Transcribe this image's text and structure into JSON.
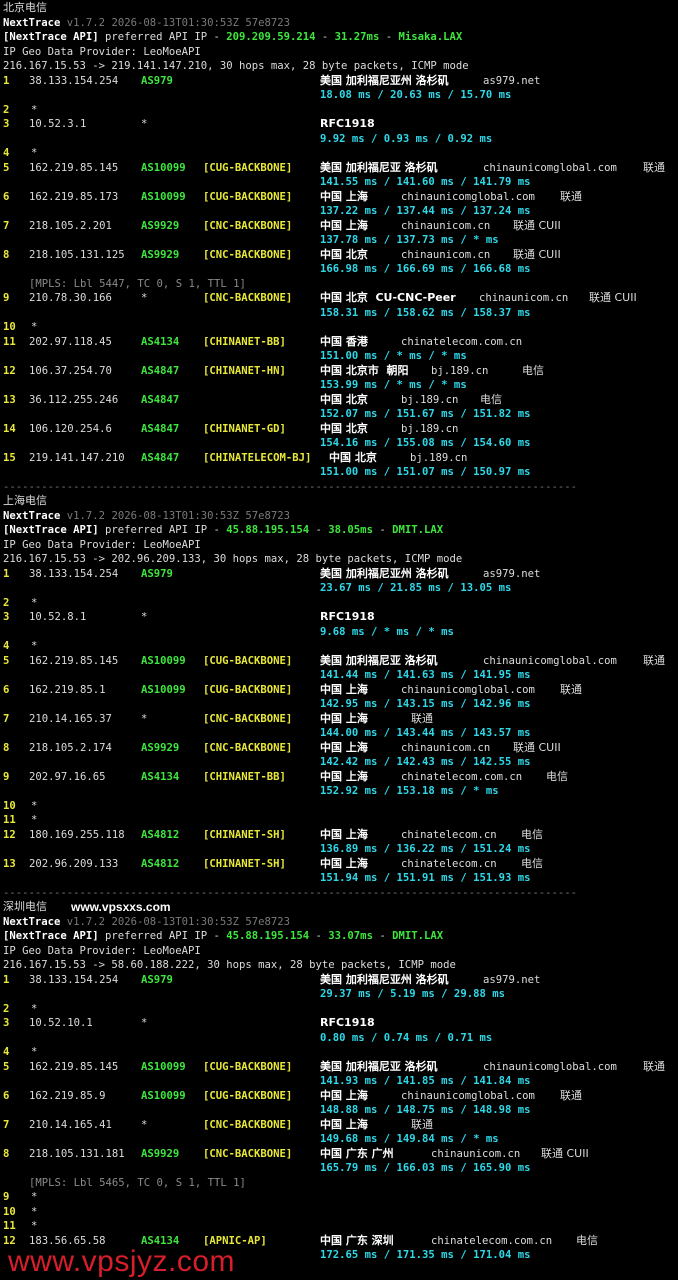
{
  "sections": [
    {
      "title": "北京电信",
      "version_line": {
        "name": "NextTrace",
        "meta": "v1.7.2 2026-08-13T01:30:53Z 57e8723"
      },
      "api_line": {
        "tag": "[NextTrace API]",
        "text": " preferred API IP - ",
        "ip": "209.209.59.214",
        "dash1": " - ",
        "latency": "31.27ms",
        "dash2": " - ",
        "node": "Misaka.LAX"
      },
      "geo_provider": "IP Geo Data Provider: LeoMoeAPI",
      "route_line": "216.167.15.53 -> 219.141.147.210, 30 hops max, 28 byte packets, ICMP mode",
      "rows": [
        {
          "hop": "1",
          "ip": "38.133.154.254",
          "asn": "AS979",
          "tag": "",
          "geo": "美国 加利福尼亚州 洛杉矶",
          "host": "as979.net",
          "isp": ""
        },
        {
          "rtt": "18.08 ms / 20.63 ms / 15.70 ms"
        },
        {
          "hop": "2",
          "ip": "*"
        },
        {
          "hop": "3",
          "ip": "10.52.3.1",
          "asn": "*",
          "geo": "RFC1918"
        },
        {
          "rtt": "9.92 ms / 0.93 ms / 0.92 ms"
        },
        {
          "hop": "4",
          "ip": "*"
        },
        {
          "hop": "5",
          "ip": "162.219.85.145",
          "asn": "AS10099",
          "tag": "[CUG-BACKBONE]",
          "geo": "美国 加利福尼亚 洛杉矶",
          "host": "chinaunicomglobal.com",
          "isp": "联通"
        },
        {
          "rtt": "141.55 ms / 141.60 ms / 141.79 ms"
        },
        {
          "hop": "6",
          "ip": "162.219.85.173",
          "asn": "AS10099",
          "tag": "[CUG-BACKBONE]",
          "geo": "中国 上海",
          "host": "chinaunicomglobal.com",
          "isp": "联通"
        },
        {
          "rtt": "137.22 ms / 137.44 ms / 137.24 ms"
        },
        {
          "hop": "7",
          "ip": "218.105.2.201",
          "asn": "AS9929",
          "tag": "[CNC-BACKBONE]",
          "geo": "中国 上海",
          "host": "chinaunicom.cn",
          "isp": "联通 CUII"
        },
        {
          "rtt": "137.78 ms / 137.73 ms / * ms"
        },
        {
          "hop": "8",
          "ip": "218.105.131.125",
          "asn": "AS9929",
          "tag": "[CNC-BACKBONE]",
          "geo": "中国 北京",
          "host": "chinaunicom.cn",
          "isp": "联通 CUII"
        },
        {
          "rtt": "166.98 ms / 166.69 ms / 166.68 ms"
        },
        {
          "mpls": "[MPLS: Lbl 5447, TC 0, S 1, TTL 1]"
        },
        {
          "hop": "9",
          "ip": "210.78.30.166",
          "asn": "*",
          "tag": "[CNC-BACKBONE]",
          "geo": "中国 北京  CU-CNC-Peer",
          "host": "chinaunicom.cn",
          "isp": "联通 CUII"
        },
        {
          "rtt": "158.31 ms / 158.62 ms / 158.37 ms"
        },
        {
          "hop": "10",
          "ip": "*"
        },
        {
          "hop": "11",
          "ip": "202.97.118.45",
          "asn": "AS4134",
          "tag": "[CHINANET-BB]",
          "geo": "中国 香港",
          "host": "chinatelecom.com.cn",
          "isp": ""
        },
        {
          "rtt": "151.00 ms / * ms / * ms"
        },
        {
          "hop": "12",
          "ip": "106.37.254.70",
          "asn": "AS4847",
          "tag": "[CHINANET-HN]",
          "geo": "中国 北京市  朝阳",
          "host": "bj.189.cn",
          "isp": "电信"
        },
        {
          "rtt": "153.99 ms / * ms / * ms"
        },
        {
          "hop": "13",
          "ip": "36.112.255.246",
          "asn": "AS4847",
          "tag": "",
          "geo": "中国 北京",
          "host": "bj.189.cn",
          "isp": "电信"
        },
        {
          "rtt": "152.07 ms / 151.67 ms / 151.82 ms"
        },
        {
          "hop": "14",
          "ip": "106.120.254.6",
          "asn": "AS4847",
          "tag": "[CHINANET-GD]",
          "geo": "中国 北京",
          "host": "bj.189.cn",
          "isp": ""
        },
        {
          "rtt": "154.16 ms / 155.08 ms / 154.60 ms"
        },
        {
          "hop": "15",
          "ip": "219.141.147.210",
          "asn": "AS4847",
          "tag": "[CHINATELECOM-BJ]",
          "geo": "中国 北京",
          "host": "bj.189.cn",
          "isp": "",
          "geo_shift": true
        },
        {
          "rtt": "151.00 ms / 151.07 ms / 150.97 ms"
        }
      ]
    },
    {
      "title": "上海电信",
      "version_line": {
        "name": "NextTrace",
        "meta": "v1.7.2 2026-08-13T01:30:53Z 57e8723"
      },
      "api_line": {
        "tag": "[NextTrace API]",
        "text": " preferred API IP - ",
        "ip": "45.88.195.154",
        "dash1": " - ",
        "latency": "38.05ms",
        "dash2": " - ",
        "node": "DMIT.LAX"
      },
      "geo_provider": "IP Geo Data Provider: LeoMoeAPI",
      "route_line": "216.167.15.53 -> 202.96.209.133, 30 hops max, 28 byte packets, ICMP mode",
      "rows": [
        {
          "hop": "1",
          "ip": "38.133.154.254",
          "asn": "AS979",
          "tag": "",
          "geo": "美国 加利福尼亚州 洛杉矶",
          "host": "as979.net",
          "isp": ""
        },
        {
          "rtt": "23.67 ms / 21.85 ms / 13.05 ms"
        },
        {
          "hop": "2",
          "ip": "*"
        },
        {
          "hop": "3",
          "ip": "10.52.8.1",
          "asn": "*",
          "geo": "RFC1918"
        },
        {
          "rtt": "9.68 ms / * ms / * ms"
        },
        {
          "hop": "4",
          "ip": "*"
        },
        {
          "hop": "5",
          "ip": "162.219.85.145",
          "asn": "AS10099",
          "tag": "[CUG-BACKBONE]",
          "geo": "美国 加利福尼亚 洛杉矶",
          "host": "chinaunicomglobal.com",
          "isp": "联通"
        },
        {
          "rtt": "141.44 ms / 141.63 ms / 141.95 ms"
        },
        {
          "hop": "6",
          "ip": "162.219.85.1",
          "asn": "AS10099",
          "tag": "[CUG-BACKBONE]",
          "geo": "中国 上海",
          "host": "chinaunicomglobal.com",
          "isp": "联通"
        },
        {
          "rtt": "142.95 ms / 143.15 ms / 142.96 ms"
        },
        {
          "hop": "7",
          "ip": "210.14.165.37",
          "asn": "*",
          "tag": "[CNC-BACKBONE]",
          "geo": "中国 上海",
          "host": "",
          "isp": "联通"
        },
        {
          "rtt": "144.00 ms / 143.44 ms / 143.57 ms"
        },
        {
          "hop": "8",
          "ip": "218.105.2.174",
          "asn": "AS9929",
          "tag": "[CNC-BACKBONE]",
          "geo": "中国 上海",
          "host": "chinaunicom.cn",
          "isp": "联通 CUII"
        },
        {
          "rtt": "142.42 ms / 142.43 ms / 142.55 ms"
        },
        {
          "hop": "9",
          "ip": "202.97.16.65",
          "asn": "AS4134",
          "tag": "[CHINANET-BB]",
          "geo": "中国 上海",
          "host": "chinatelecom.com.cn",
          "isp": "电信"
        },
        {
          "rtt": "152.92 ms / 153.18 ms / * ms"
        },
        {
          "hop": "10",
          "ip": "*"
        },
        {
          "hop": "11",
          "ip": "*"
        },
        {
          "hop": "12",
          "ip": "180.169.255.118",
          "asn": "AS4812",
          "tag": "[CHINANET-SH]",
          "geo": "中国 上海",
          "host": "chinatelecom.cn",
          "isp": "电信"
        },
        {
          "rtt": "136.89 ms / 136.22 ms / 151.24 ms"
        },
        {
          "hop": "13",
          "ip": "202.96.209.133",
          "asn": "AS4812",
          "tag": "[CHINANET-SH]",
          "geo": "中国 上海",
          "host": "chinatelecom.cn",
          "isp": "电信"
        },
        {
          "rtt": "151.94 ms / 151.91 ms / 151.93 ms"
        }
      ]
    },
    {
      "title": "深圳电信",
      "brand": "www.vpsxxs.com",
      "version_line": {
        "name": "NextTrace",
        "meta": "v1.7.2 2026-08-13T01:30:53Z 57e8723"
      },
      "api_line": {
        "tag": "[NextTrace API]",
        "text": " preferred API IP - ",
        "ip": "45.88.195.154",
        "dash1": " - ",
        "latency": "33.07ms",
        "dash2": " - ",
        "node": "DMIT.LAX"
      },
      "geo_provider": "IP Geo Data Provider: LeoMoeAPI",
      "route_line": "216.167.15.53 -> 58.60.188.222, 30 hops max, 28 byte packets, ICMP mode",
      "rows": [
        {
          "hop": "1",
          "ip": "38.133.154.254",
          "asn": "AS979",
          "tag": "",
          "geo": "美国 加利福尼亚州 洛杉矶",
          "host": "as979.net",
          "isp": ""
        },
        {
          "rtt": "29.37 ms / 5.19 ms / 29.88 ms"
        },
        {
          "hop": "2",
          "ip": "*"
        },
        {
          "hop": "3",
          "ip": "10.52.10.1",
          "asn": "*",
          "geo": "RFC1918"
        },
        {
          "rtt": "0.80 ms / 0.74 ms / 0.71 ms"
        },
        {
          "hop": "4",
          "ip": "*"
        },
        {
          "hop": "5",
          "ip": "162.219.85.145",
          "asn": "AS10099",
          "tag": "[CUG-BACKBONE]",
          "geo": "美国 加利福尼亚 洛杉矶",
          "host": "chinaunicomglobal.com",
          "isp": "联通"
        },
        {
          "rtt": "141.93 ms / 141.85 ms / 141.84 ms"
        },
        {
          "hop": "6",
          "ip": "162.219.85.9",
          "asn": "AS10099",
          "tag": "[CUG-BACKBONE]",
          "geo": "中国 上海",
          "host": "chinaunicomglobal.com",
          "isp": "联通"
        },
        {
          "rtt": "148.88 ms / 148.75 ms / 148.98 ms"
        },
        {
          "hop": "7",
          "ip": "210.14.165.41",
          "asn": "*",
          "tag": "[CNC-BACKBONE]",
          "geo": "中国 上海",
          "host": "",
          "isp": "联通"
        },
        {
          "rtt": "149.68 ms / 149.84 ms / * ms"
        },
        {
          "hop": "8",
          "ip": "218.105.131.181",
          "asn": "AS9929",
          "tag": "[CNC-BACKBONE]",
          "geo": "中国 广东 广州",
          "host": "chinaunicom.cn",
          "isp": "联通 CUII"
        },
        {
          "rtt": "165.79 ms / 166.03 ms / 165.90 ms"
        },
        {
          "mpls": "[MPLS: Lbl 5465, TC 0, S 1, TTL 1]"
        },
        {
          "hop": "9",
          "ip": "*"
        },
        {
          "hop": "10",
          "ip": "*"
        },
        {
          "hop": "11",
          "ip": "*"
        },
        {
          "hop": "12",
          "ip": "183.56.65.58",
          "asn": "AS4134",
          "tag": "[APNIC-AP]",
          "geo": "中国 广东 深圳",
          "host": "chinatelecom.com.cn",
          "isp": "电信"
        },
        {
          "rtt": "172.65 ms / 171.35 ms / 171.04 ms"
        }
      ]
    }
  ],
  "separator": "------------------------------------------------------------------------------------------",
  "watermark": "www.vpsjyz.com",
  "colors": {
    "background": "#000000",
    "hop": "#e8e83a",
    "asn": "#3ee63e",
    "rtt": "#2fd8e8",
    "watermark": "#d81e2a"
  }
}
